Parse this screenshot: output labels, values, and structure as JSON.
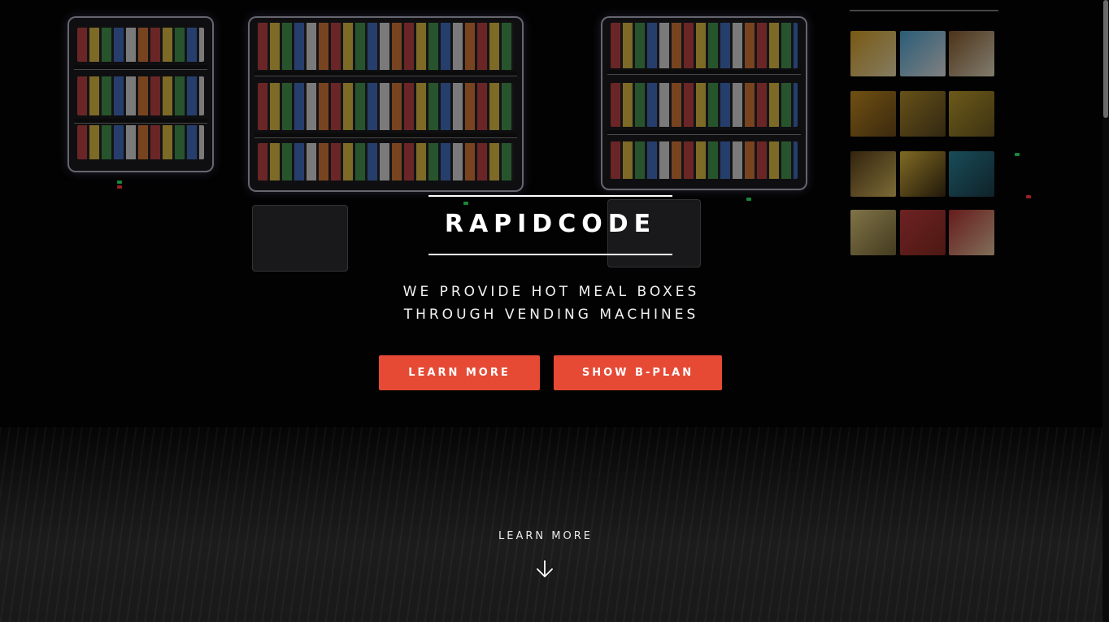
{
  "hero": {
    "brand": "RAPIDCODE",
    "tagline_line1": "WE PROVIDE HOT MEAL BOXES",
    "tagline_line2": "THROUGH VENDING MACHINES"
  },
  "actions": {
    "learn_more_label": "LEARN MORE",
    "show_bplan_label": "SHOW B-PLAN"
  },
  "scroll_cue": {
    "label": "LEARN MORE",
    "icon": "arrow-down-icon"
  },
  "colors": {
    "accent": "#e64a35",
    "background": "#020202",
    "text": "#ffffff"
  },
  "background_image": {
    "subject": "vending-machines-icon"
  }
}
